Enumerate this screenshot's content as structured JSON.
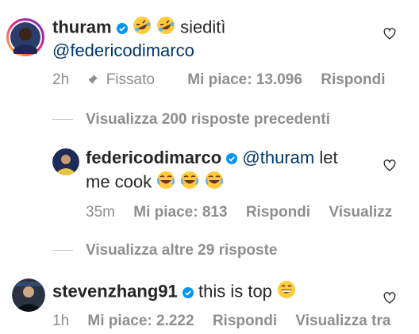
{
  "comments": [
    {
      "username": "thuram",
      "text_line1": "sieditì",
      "mention": "@federicodimarco",
      "time": "2h",
      "pinned_label": "Fissato",
      "likes": "Mi piace: 13.096",
      "reply": "Rispondi",
      "emojis": [
        "rofl-emoji",
        "rofl-emoji"
      ]
    },
    {
      "username": "federicodimarco",
      "mention": "@thuram",
      "text_part1": "let",
      "text_line2": "me cook",
      "time": "35m",
      "likes": "Mi piace: 813",
      "reply": "Rispondi",
      "translate": "Visualizz",
      "emojis": [
        "joy-emoji",
        "joy-emoji",
        "joy-emoji"
      ]
    },
    {
      "username": "stevenzhang91",
      "text": "this is top",
      "time": "1h",
      "likes": "Mi piace: 2.222",
      "reply": "Rispondi",
      "translate": "Visualizza tra",
      "emojis": [
        "grin-emoji"
      ]
    }
  ],
  "view_replies_1": "Visualizza 200 risposte precedenti",
  "view_replies_2": "Visualizza altre 29 risposte",
  "colors": {
    "verified": "#0095f6",
    "meta": "#8e8e8e",
    "mention": "#00376b",
    "text": "#262626"
  }
}
